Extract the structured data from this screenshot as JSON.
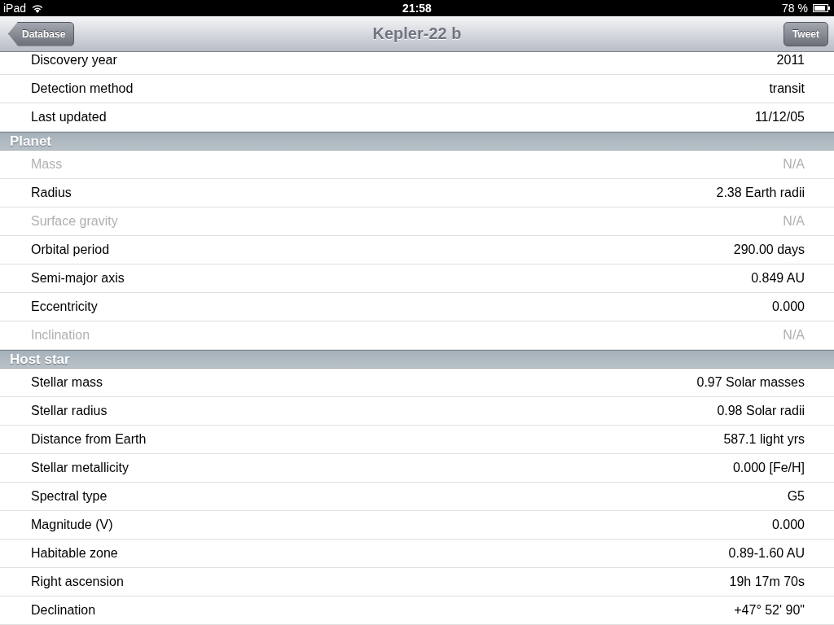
{
  "status_bar": {
    "device": "iPad",
    "time": "21:58",
    "battery": "78 %"
  },
  "nav_bar": {
    "back_button": "Database",
    "title": "Kepler-22 b",
    "action_button": "Tweet"
  },
  "sections": [
    {
      "rows": [
        {
          "label": "Discovery year",
          "value": "2011",
          "disabled": false
        },
        {
          "label": "Detection method",
          "value": "transit",
          "disabled": false
        },
        {
          "label": "Last updated",
          "value": "11/12/05",
          "disabled": false
        }
      ]
    },
    {
      "header": "Planet",
      "rows": [
        {
          "label": "Mass",
          "value": "N/A",
          "disabled": true
        },
        {
          "label": "Radius",
          "value": "2.38 Earth radii",
          "disabled": false
        },
        {
          "label": "Surface gravity",
          "value": "N/A",
          "disabled": true
        },
        {
          "label": "Orbital period",
          "value": "290.00 days",
          "disabled": false
        },
        {
          "label": "Semi-major axis",
          "value": "0.849 AU",
          "disabled": false
        },
        {
          "label": "Eccentricity",
          "value": "0.000",
          "disabled": false
        },
        {
          "label": "Inclination",
          "value": "N/A",
          "disabled": true
        }
      ]
    },
    {
      "header": "Host star",
      "rows": [
        {
          "label": "Stellar mass",
          "value": "0.97 Solar masses",
          "disabled": false
        },
        {
          "label": "Stellar radius",
          "value": "0.98 Solar radii",
          "disabled": false
        },
        {
          "label": "Distance from Earth",
          "value": "587.1 light yrs",
          "disabled": false
        },
        {
          "label": "Stellar metallicity",
          "value": "0.000 [Fe/H]",
          "disabled": false
        },
        {
          "label": "Spectral type",
          "value": "G5",
          "disabled": false
        },
        {
          "label": "Magnitude (V)",
          "value": "0.000",
          "disabled": false
        },
        {
          "label": "Habitable zone",
          "value": "0.89-1.60 AU",
          "disabled": false
        },
        {
          "label": "Right ascension",
          "value": "19h 17m 70s",
          "disabled": false
        },
        {
          "label": "Declination",
          "value": "+47° 52' 90\"",
          "disabled": false
        }
      ]
    }
  ]
}
